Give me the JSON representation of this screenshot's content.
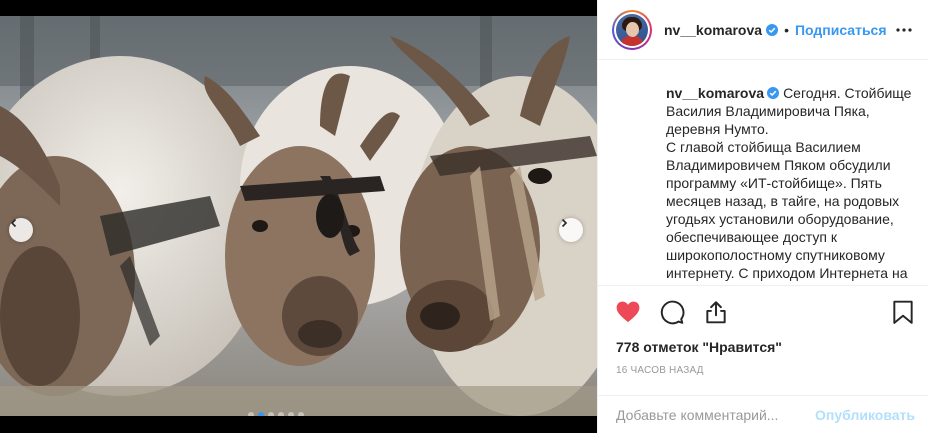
{
  "post": {
    "username": "nv__komarova",
    "follow_label": "Подписаться",
    "separator": "•",
    "caption_lines": [
      "Сегодня. Стойбище Василия Владимировича Пяка, деревня Нумто.",
      "С главой стойбища Василием Владимировичем Пяком обсудили программу «ИТ-стойбище». Пять месяцев назад, в тайге, на родовых угодьях установили оборудование, обеспечивающее доступ к широкополостному спутниковому интернету. С приходом Интернета на"
    ],
    "likes_text": "778 отметок \"Нравится\"",
    "timestamp": "16 часов назад"
  },
  "comment": {
    "placeholder": "Добавьте комментарий...",
    "publish_label": "Опубликовать"
  },
  "carousel": {
    "slide_count": 6,
    "active_slide": 1
  },
  "icons": {
    "like": "heart-filled-icon",
    "comment": "comment-bubble-icon",
    "share": "share-icon",
    "save": "bookmark-icon",
    "more": "more-dots-icon",
    "verified": "verified-badge-icon",
    "prev": "chevron-left-icon",
    "next": "chevron-right-icon"
  },
  "colors": {
    "accent": "#3897f0",
    "like_red": "#ed4956",
    "publish_disabled": "#b2dffc",
    "muted": "#999999"
  }
}
